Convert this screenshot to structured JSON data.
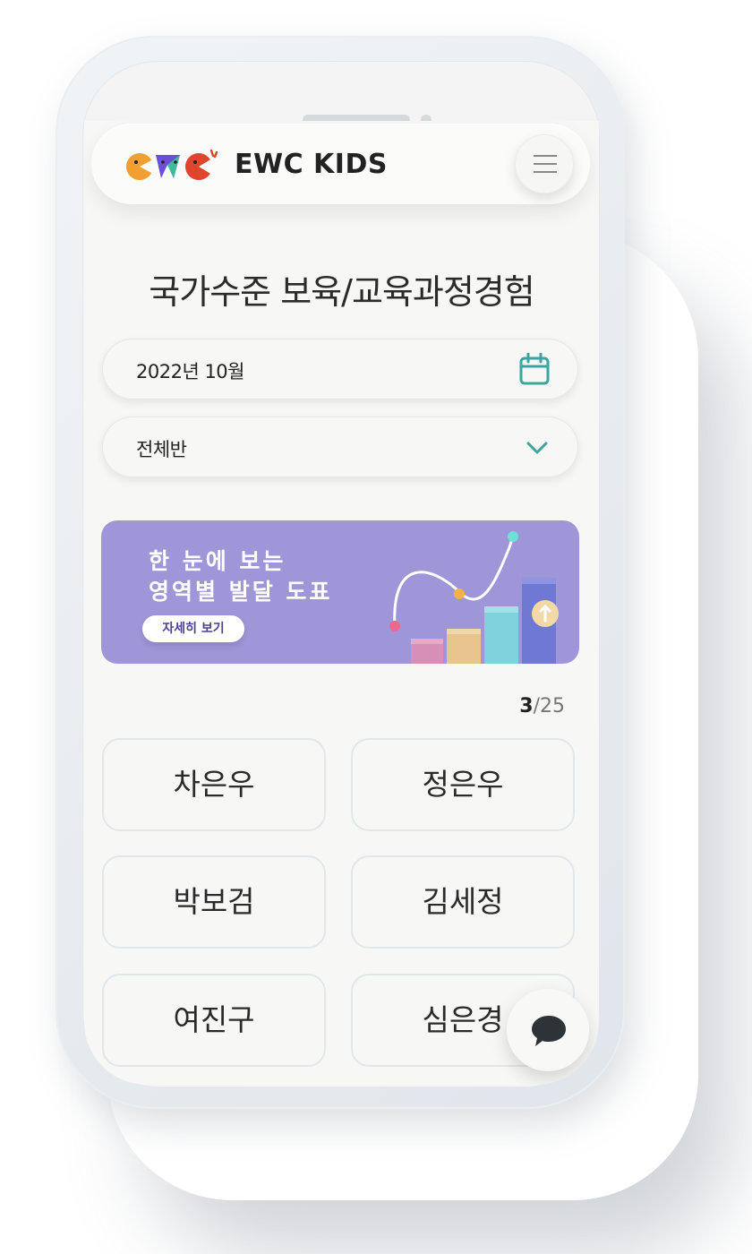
{
  "app": {
    "brand_name": "EWC KIDS",
    "logo_icon": "ewc-logo-icon"
  },
  "header": {
    "menu_icon": "hamburger-menu-icon"
  },
  "page": {
    "title": "국가수준 보육/교육과정경험"
  },
  "filters": {
    "date_value": "2022년 10월",
    "date_icon": "calendar-icon",
    "class_value": "전체반",
    "class_icon": "chevron-down-icon"
  },
  "banner": {
    "line1": "한 눈에 보는",
    "line2": "영역별 발달 도표",
    "cta_label": "자세히 보기",
    "background": "#9f96d9"
  },
  "pagination": {
    "current": "3",
    "separator": "/",
    "total": "25"
  },
  "children": [
    {
      "name": "차은우"
    },
    {
      "name": "정은우"
    },
    {
      "name": "박보검"
    },
    {
      "name": "김세정"
    },
    {
      "name": "여진구"
    },
    {
      "name": "심은경"
    }
  ],
  "chat": {
    "icon": "chat-bubble-icon"
  },
  "colors": {
    "accent_teal": "#3aa6a0",
    "card_border": "#e1e8ec",
    "screen_bg": "#f7f7f6"
  }
}
